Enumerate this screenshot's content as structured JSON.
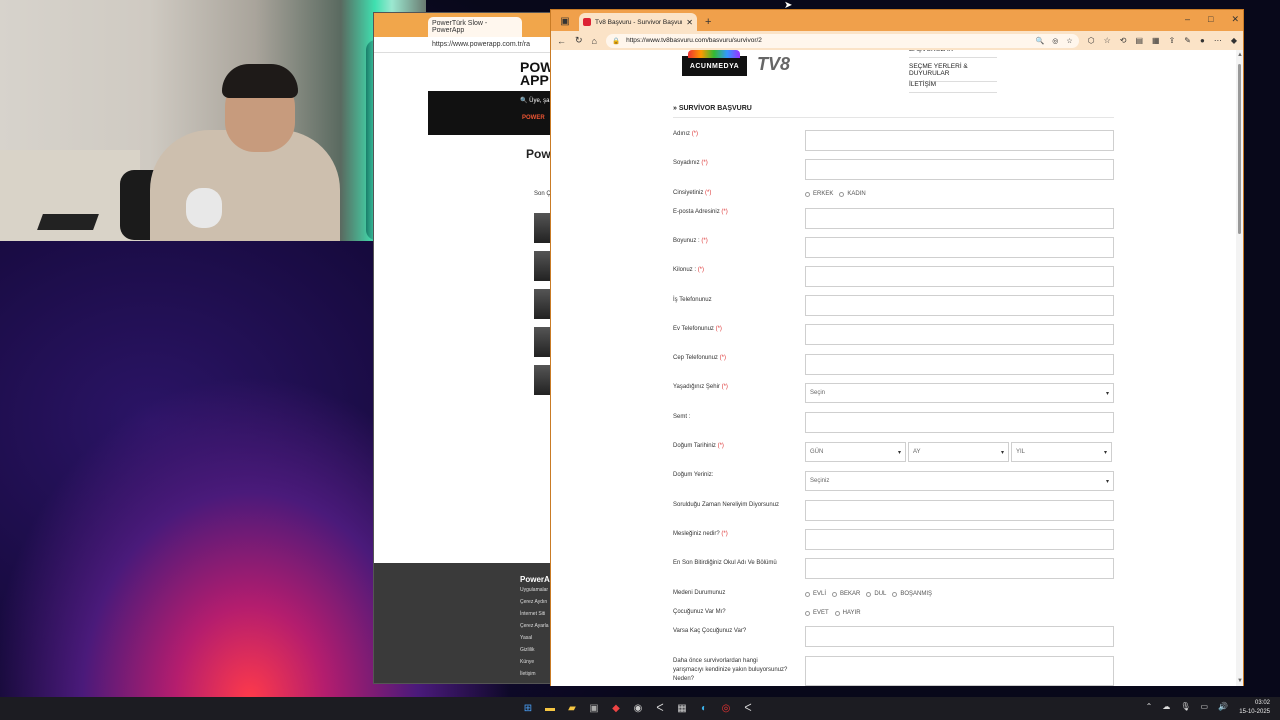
{
  "background_browser": {
    "tab_title": "PowerTürk Slow - PowerApp",
    "url": "https://www.powerapp.com.tr/ra",
    "logo": "POWER APP",
    "search_placeholder": "Üye, şa",
    "page_title": "Pow",
    "subtitle": "Son Ç",
    "footer_title": "PowerAp",
    "footer_links": [
      "Uygulamalar",
      "Çerez Aydın",
      "İnternet Siti",
      "Çerez Ayarla",
      "Yasal",
      "Gizlilik",
      "Künye",
      "İletişim"
    ]
  },
  "browser": {
    "tab_title": "Tv8 Başvuru - Survivor Başvurusu",
    "url": "https://www.tv8basvuru.com/basvuru/survivor/2",
    "new_tab": "+",
    "minimize": "–",
    "maximize": "□",
    "close": "✕"
  },
  "site": {
    "logo_acun": "ACUNMEDYA",
    "logo_tv8": "TV8",
    "nav": [
      "BAŞVURULAR",
      "SEÇME YERLERİ & DUYURULAR",
      "İLETİŞİM"
    ]
  },
  "form": {
    "title": "» SURVİVOR BAŞVURU",
    "required_mark": "(*)",
    "fields": {
      "ad": "Adınız",
      "soyad": "Soyadınız",
      "cinsiyet": "Cinsiyetiniz",
      "eposta": "E-posta Adresiniz",
      "boy": "Boyunuz :",
      "kilo": "Kilonuz :",
      "is_tel": "İş Telefonunuz",
      "ev_tel": "Ev Telefonunuz",
      "cep_tel": "Cep Telefonunuz",
      "sehir": "Yaşadığınız Şehir",
      "semt": "Semt :",
      "dogum_tarihi": "Doğum Tarihiniz",
      "dogum_yeri": "Doğum Yeriniz:",
      "zaman": "Sorulduğu Zaman Nereliyim Diyorsunuz",
      "meslek": "Mesleğiniz nedir?",
      "okul": "En Son Bitirdiğiniz Okul Adı Ve Bölümü",
      "medeni": "Medeni Durumunuz",
      "cocuk": "Çocuğunuz Var Mı?",
      "cocuk_sayi": "Varsa Kaç Çocuğunuz Var?",
      "yarismaci": "Daha önce survivorlardan hangi yarışmacıyı kendinize yakın buluyorsunuz? Neden?"
    },
    "gender_options": [
      "ERKEK",
      "KADIN"
    ],
    "city_select": "Seçin",
    "day_select": "GÜN",
    "month_select": "AY",
    "year_select": "YIL",
    "birthplace_select": "Seçiniz",
    "marital_options": [
      "EVLİ",
      "BEKAR",
      "DUL",
      "BOŞANMIŞ"
    ],
    "child_options": [
      "EVET",
      "HAYIR"
    ]
  },
  "taskbar": {
    "time": "03:02",
    "date": "15-10-2025"
  }
}
